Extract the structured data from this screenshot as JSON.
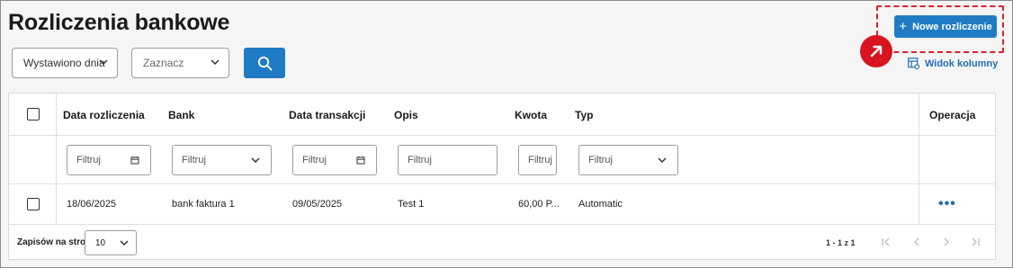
{
  "page": {
    "title": "Rozliczenia bankowe"
  },
  "filters_bar": {
    "date_select_value": "Wystawiono dnia",
    "mark_select_placeholder": "Zaznacz"
  },
  "actions": {
    "new_label": "Nowe rozliczenie",
    "column_view_label": "Widok kolumny"
  },
  "table": {
    "headers": {
      "date": "Data rozliczenia",
      "bank": "Bank",
      "transaction_date": "Data transakcji",
      "description": "Opis",
      "amount": "Kwota",
      "type": "Typ",
      "operation": "Operacja"
    },
    "filter_placeholder": "Filtruj",
    "rows": [
      {
        "date": "18/06/2025",
        "bank": "bank faktura 1",
        "transaction_date": "09/05/2025",
        "description": "Test 1",
        "amount": "60,00 P...",
        "type": "Automatic"
      }
    ]
  },
  "pagination": {
    "per_page_label": "Zapisów na stronie",
    "per_page_value": "10",
    "range_text": "1 - 1 z 1"
  },
  "colors": {
    "primary": "#1f7cc4",
    "link": "#1f6fb5",
    "highlight": "#d9232e"
  }
}
